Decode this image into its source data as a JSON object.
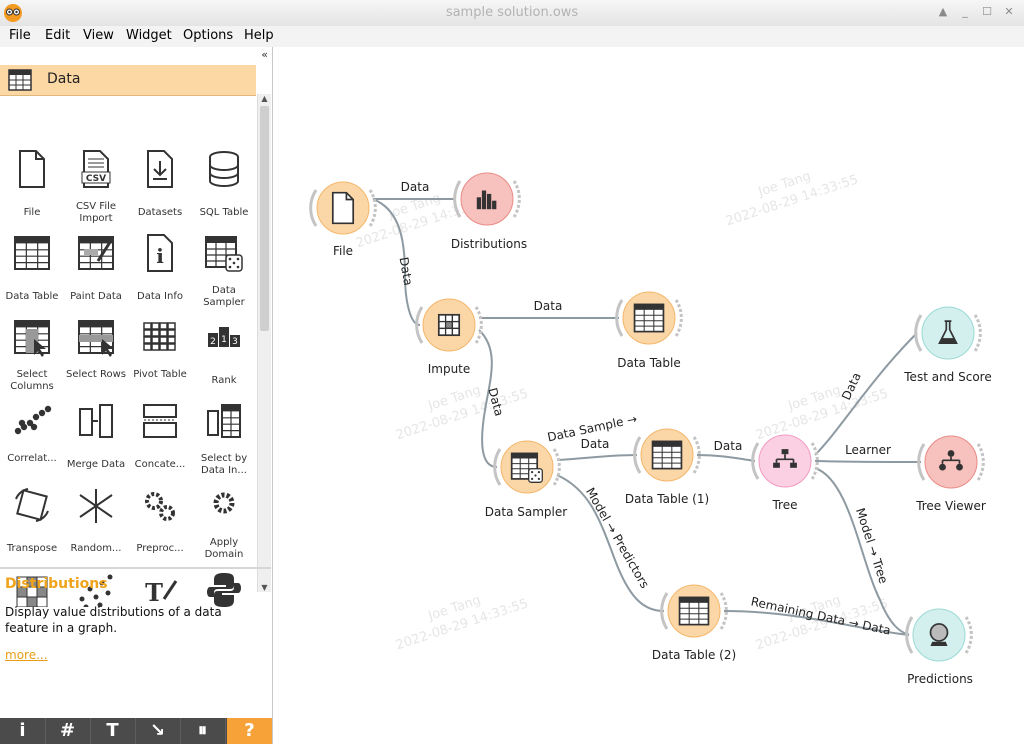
{
  "window": {
    "title": "sample solution.ows"
  },
  "menu": [
    "File",
    "Edit",
    "View",
    "Widget",
    "Options",
    "Help"
  ],
  "category": {
    "label": "Data"
  },
  "widgets": [
    {
      "label": "File",
      "icon": "file-icon"
    },
    {
      "label": "CSV File Import",
      "icon": "csv-file-icon"
    },
    {
      "label": "Datasets",
      "icon": "datasets-download-icon"
    },
    {
      "label": "SQL Table",
      "icon": "database-icon"
    },
    {
      "label": "Data Table",
      "icon": "data-table-icon"
    },
    {
      "label": "Paint Data",
      "icon": "paint-data-icon"
    },
    {
      "label": "Data Info",
      "icon": "data-info-icon"
    },
    {
      "label": "Data Sampler",
      "icon": "data-sampler-icon"
    },
    {
      "label": "Select Columns",
      "icon": "select-columns-icon"
    },
    {
      "label": "Select Rows",
      "icon": "select-rows-icon"
    },
    {
      "label": "Pivot Table",
      "icon": "pivot-table-icon"
    },
    {
      "label": "Rank",
      "icon": "rank-icon"
    },
    {
      "label": "Correlat...",
      "icon": "correlations-icon"
    },
    {
      "label": "Merge Data",
      "icon": "merge-data-icon"
    },
    {
      "label": "Concate...",
      "icon": "concatenate-icon"
    },
    {
      "label": "Select by Data In...",
      "icon": "select-by-data-index-icon"
    },
    {
      "label": "Transpose",
      "icon": "transpose-icon"
    },
    {
      "label": "Random...",
      "icon": "randomize-icon"
    },
    {
      "label": "Preproc...",
      "icon": "preprocess-icon"
    },
    {
      "label": "Apply Domain",
      "icon": "apply-domain-icon"
    },
    {
      "label": "",
      "icon": "color-grid-icon"
    },
    {
      "label": "",
      "icon": "scatter-dots-icon"
    },
    {
      "label": "",
      "icon": "text-edit-icon"
    },
    {
      "label": "",
      "icon": "python-icon"
    }
  ],
  "info": {
    "title": "Distributions",
    "description": "Display value distributions of a data feature in a graph.",
    "more": "more..."
  },
  "toolbar": {
    "info": "i",
    "grid": "#",
    "text": "T",
    "arrow": "↘",
    "pause": "⏸",
    "help": "?"
  },
  "nodes": [
    {
      "id": "file",
      "label": "File",
      "color": "#fbd7a8",
      "ring": "#f4b66a",
      "icon": "file-icon"
    },
    {
      "id": "distributions",
      "label": "Distributions",
      "color": "#f7c1be",
      "ring": "#e98b85",
      "icon": "distributions-icon"
    },
    {
      "id": "impute",
      "label": "Impute",
      "color": "#fbd7a8",
      "ring": "#f4b66a",
      "icon": "impute-icon"
    },
    {
      "id": "datatable",
      "label": "Data Table",
      "color": "#fbd7a8",
      "ring": "#f4b66a",
      "icon": "data-table-icon"
    },
    {
      "id": "testscore",
      "label": "Test and Score",
      "color": "#d3f0ef",
      "ring": "#9ad9d4",
      "icon": "test-score-icon"
    },
    {
      "id": "sampler",
      "label": "Data Sampler",
      "color": "#fbd7a8",
      "ring": "#f4b66a",
      "icon": "data-sampler-icon"
    },
    {
      "id": "datatable1",
      "label": "Data Table (1)",
      "color": "#fbd7a8",
      "ring": "#f4b66a",
      "icon": "data-table-icon"
    },
    {
      "id": "tree",
      "label": "Tree",
      "color": "#fbd0e2",
      "ring": "#f39bc2",
      "icon": "tree-icon"
    },
    {
      "id": "treeviewer",
      "label": "Tree Viewer",
      "color": "#f7c1be",
      "ring": "#e98b85",
      "icon": "tree-viewer-icon"
    },
    {
      "id": "datatable2",
      "label": "Data Table (2)",
      "color": "#fbd7a8",
      "ring": "#f4b66a",
      "icon": "data-table-icon"
    },
    {
      "id": "predictions",
      "label": "Predictions",
      "color": "#d3f0ef",
      "ring": "#9ad9d4",
      "icon": "predictions-icon"
    }
  ],
  "links": [
    {
      "label": "Data"
    },
    {
      "label": "Data"
    },
    {
      "label": "Data"
    },
    {
      "label": "Data"
    },
    {
      "label": "Data Sample →"
    },
    {
      "label": "Data"
    },
    {
      "label": "Data"
    },
    {
      "label": "Learner"
    },
    {
      "label": "Model → Tree"
    },
    {
      "label": "Model → Predictors"
    },
    {
      "label": "Remaining Data → Data"
    },
    {
      "label": "Data"
    }
  ],
  "watermark": {
    "user": "Joe Tang",
    "timestamp": "2022-08-29 14:33:55"
  }
}
